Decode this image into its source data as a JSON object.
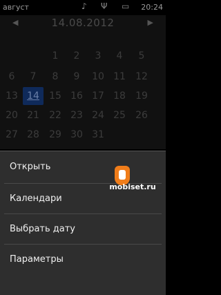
{
  "status_bar": {
    "month": "август",
    "time": "20:24",
    "icons": [
      "music-off-icon",
      "signal-icon",
      "battery-icon"
    ]
  },
  "calendar": {
    "date": "14.08.2012",
    "rows": [
      [
        "",
        "",
        "1",
        "2",
        "3",
        "4",
        "5"
      ],
      [
        "6",
        "7",
        "8",
        "9",
        "10",
        "11",
        "12"
      ],
      [
        "13",
        "14",
        "15",
        "16",
        "17",
        "18",
        "19"
      ],
      [
        "20",
        "21",
        "22",
        "23",
        "24",
        "25",
        "26"
      ],
      [
        "27",
        "28",
        "29",
        "30",
        "31",
        "",
        ""
      ]
    ],
    "today": "14"
  },
  "menu": {
    "items": [
      {
        "label": "Открыть"
      },
      {
        "label": "Календари"
      },
      {
        "label": "Выбрать дату"
      },
      {
        "label": "Параметры"
      }
    ]
  },
  "watermark": {
    "text": "mobiset.ru"
  }
}
